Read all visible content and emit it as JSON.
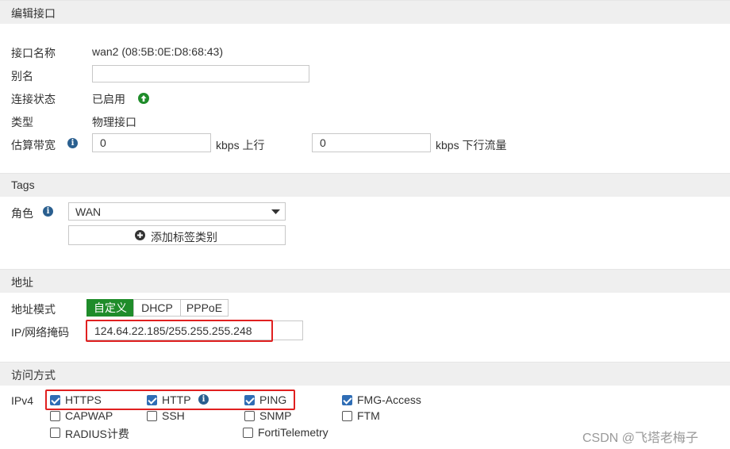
{
  "sections": {
    "edit": "编辑接口",
    "tags": "Tags",
    "address": "地址",
    "access": "访问方式"
  },
  "interface": {
    "name_label": "接口名称",
    "name_value": "wan2 (08:5B:0E:D8:68:43)",
    "alias_label": "别名",
    "alias_value": "",
    "status_label": "连接状态",
    "status_value": "已启用",
    "type_label": "类型",
    "type_value": "物理接口",
    "bandwidth_label": "估算带宽",
    "up_value": "0",
    "up_unit": "kbps 上行",
    "down_value": "0",
    "down_unit": "kbps 下行流量"
  },
  "tags": {
    "role_label": "角色",
    "role_value": "WAN",
    "add_tag_button": "添加标签类别"
  },
  "address": {
    "mode_label": "地址模式",
    "modes": [
      "自定义",
      "DHCP",
      "PPPoE"
    ],
    "active_mode": "自定义",
    "ip_label": "IP/网络掩码",
    "ip_value": "124.64.22.185/255.255.255.248"
  },
  "access": {
    "ipv4_label": "IPv4",
    "options": [
      {
        "label": "HTTPS",
        "checked": true
      },
      {
        "label": "HTTP",
        "checked": true
      },
      {
        "label": "PING",
        "checked": true
      },
      {
        "label": "FMG-Access",
        "checked": true
      },
      {
        "label": "CAPWAP",
        "checked": false
      },
      {
        "label": "SSH",
        "checked": false
      },
      {
        "label": "SNMP",
        "checked": false
      },
      {
        "label": "FTM",
        "checked": false
      },
      {
        "label": "RADIUS计费",
        "checked": false
      },
      {
        "label": "FortiTelemetry",
        "checked": false
      }
    ]
  },
  "watermark": "CSDN @飞塔老梅子",
  "colors": {
    "accent_green": "#1f8c2a",
    "checkbox_blue": "#2f6db5",
    "highlight_red": "#e02020",
    "info_blue": "#2a5f8f"
  }
}
